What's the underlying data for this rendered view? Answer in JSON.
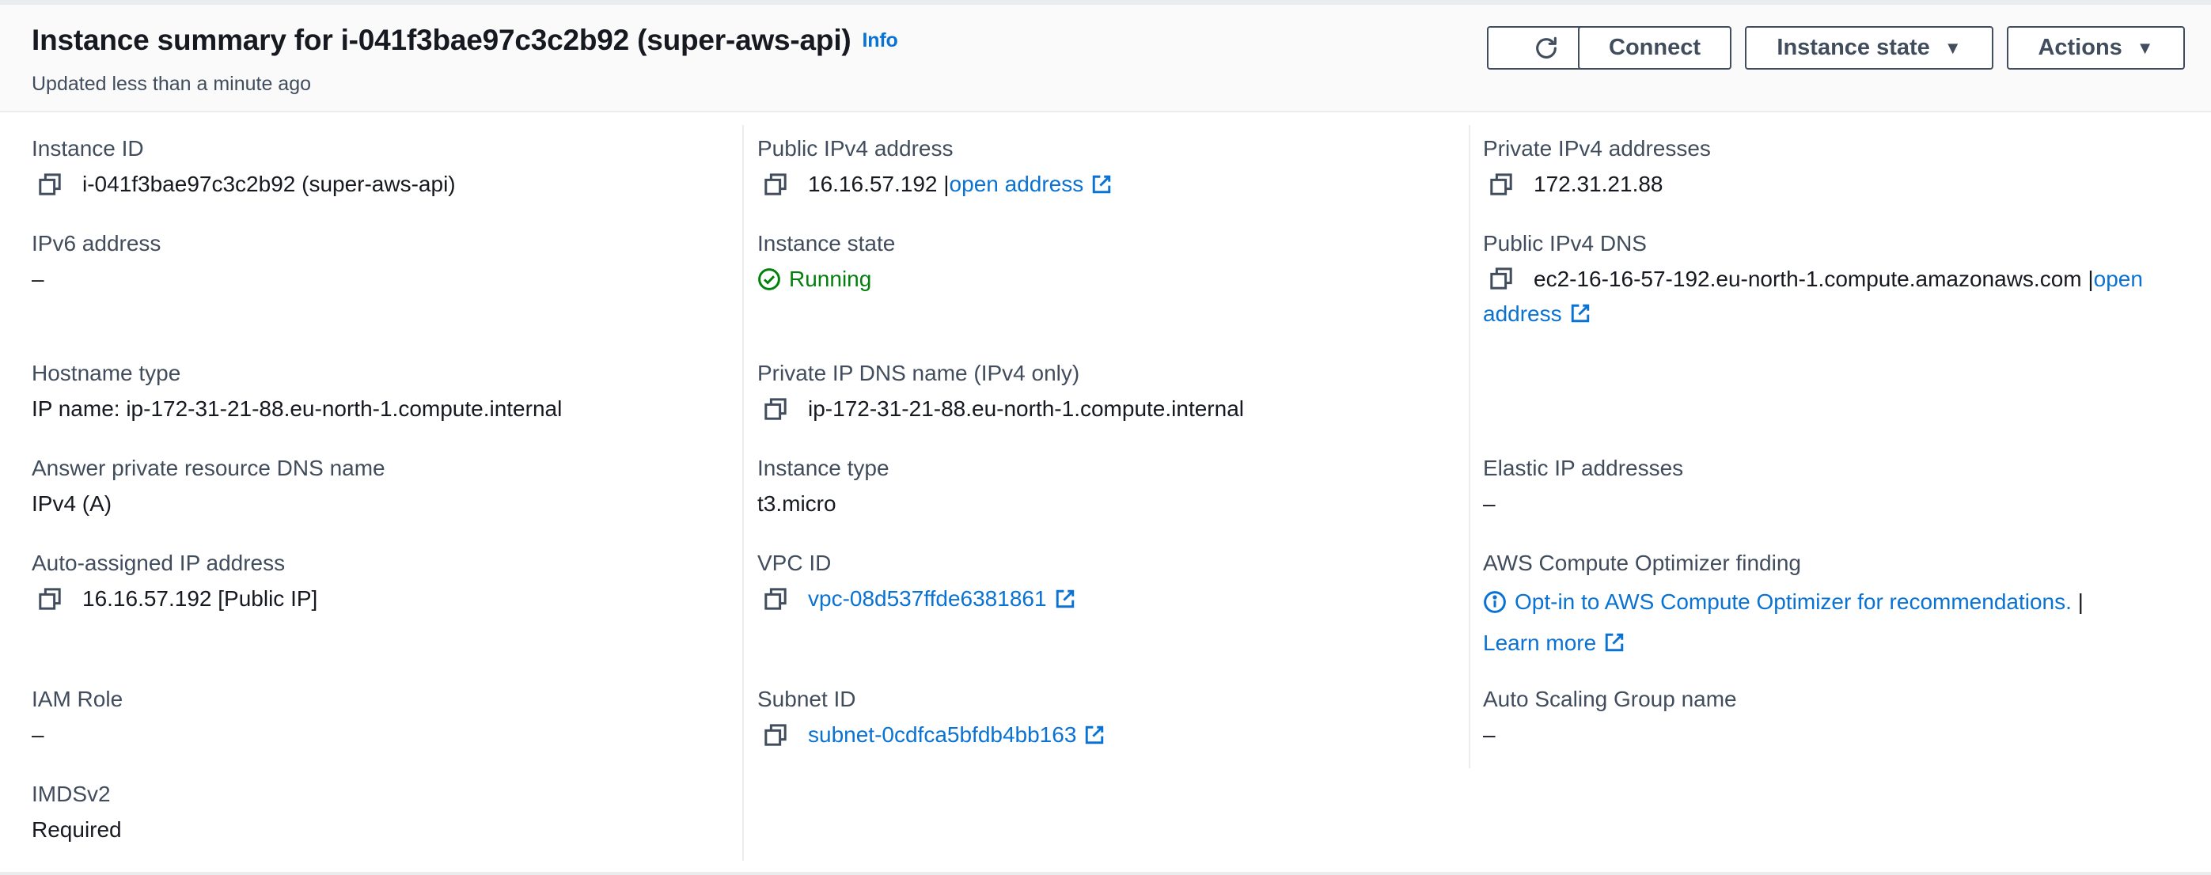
{
  "header": {
    "title": "Instance summary for i-041f3bae97c3c2b92 (super-aws-api)",
    "info": "Info",
    "subtitle": "Updated less than a minute ago",
    "buttons": {
      "connect": "Connect",
      "instance_state": "Instance state",
      "actions": "Actions"
    }
  },
  "fields": {
    "instance_id": {
      "label": "Instance ID",
      "value": "i-041f3bae97c3c2b92 (super-aws-api)"
    },
    "ipv6": {
      "label": "IPv6 address",
      "value": "–"
    },
    "hostname_type": {
      "label": "Hostname type",
      "value": "IP name: ip-172-31-21-88.eu-north-1.compute.internal"
    },
    "answer_dns": {
      "label": "Answer private resource DNS name",
      "value": "IPv4 (A)"
    },
    "auto_ip": {
      "label": "Auto-assigned IP address",
      "value": "16.16.57.192 [Public IP]"
    },
    "iam_role": {
      "label": "IAM Role",
      "value": "–"
    },
    "imdsv2": {
      "label": "IMDSv2",
      "value": "Required"
    },
    "public_ipv4": {
      "label": "Public IPv4 address",
      "value": "16.16.57.192 |",
      "link": "open address"
    },
    "instance_state": {
      "label": "Instance state",
      "value": "Running"
    },
    "private_dns": {
      "label": "Private IP DNS name (IPv4 only)",
      "value": "ip-172-31-21-88.eu-north-1.compute.internal"
    },
    "instance_type": {
      "label": "Instance type",
      "value": "t3.micro"
    },
    "vpc_id": {
      "label": "VPC ID",
      "value": "vpc-08d537ffde6381861"
    },
    "subnet_id": {
      "label": "Subnet ID",
      "value": "subnet-0cdfca5bfdb4bb163"
    },
    "private_ipv4": {
      "label": "Private IPv4 addresses",
      "value": "172.31.21.88"
    },
    "public_dns": {
      "label": "Public IPv4 DNS",
      "value": "ec2-16-16-57-192.eu-north-1.compute.amazonaws.com |",
      "link": "open address"
    },
    "elastic_ip": {
      "label": "Elastic IP addresses",
      "value": "–"
    },
    "optimizer": {
      "label": "AWS Compute Optimizer finding",
      "link": "Opt-in to AWS Compute Optimizer for recommendations.",
      "separator": " |",
      "learn_more": "Learn more"
    },
    "asg": {
      "label": "Auto Scaling Group name",
      "value": "–"
    }
  },
  "colors": {
    "link": "#0972d3",
    "success": "#037f0c",
    "text": "#16191f",
    "label": "#414d5c"
  }
}
